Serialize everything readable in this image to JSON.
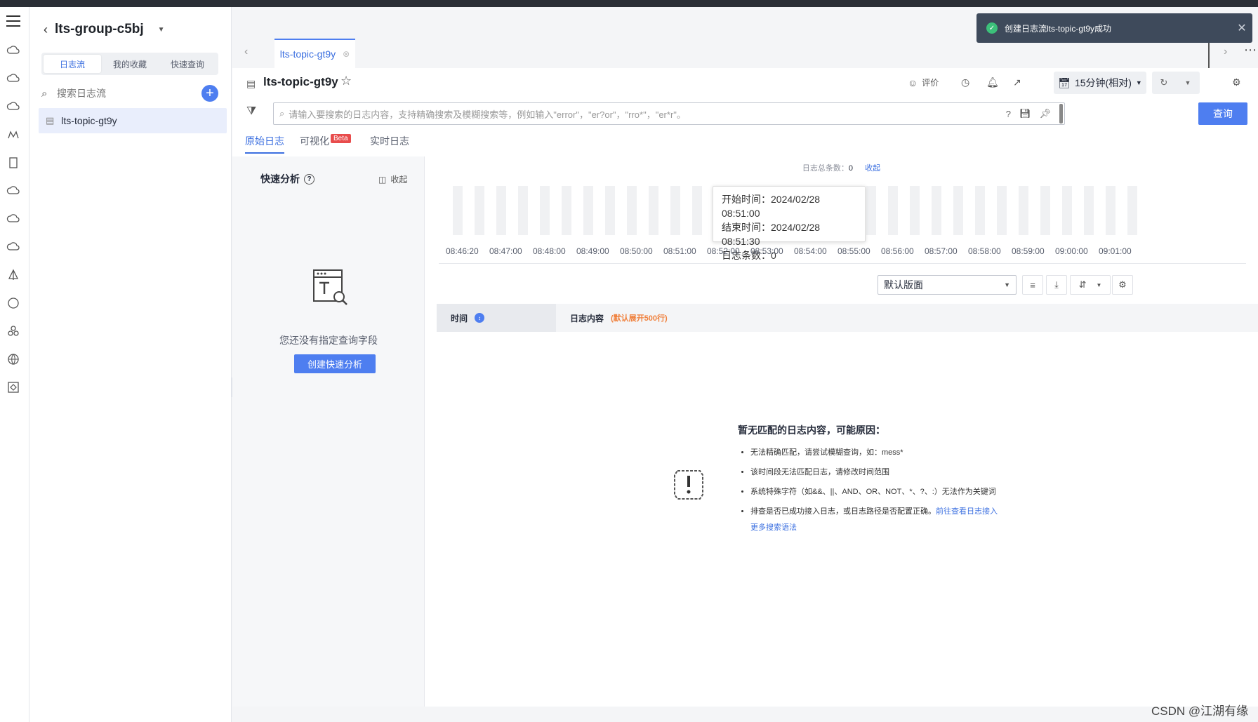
{
  "group": {
    "name": "lts-group-c5bj"
  },
  "left_panel": {
    "segments": [
      "日志流",
      "我的收藏",
      "快速查询"
    ],
    "search_placeholder": "搜索日志流",
    "stream_item": "lts-topic-gt9y"
  },
  "tabs": [
    {
      "label": "lts-topic-gt9y"
    }
  ],
  "header": {
    "title": "lts-topic-gt9y",
    "rate_label": "评价",
    "time_range": "15分钟(相对)"
  },
  "search": {
    "placeholder": "请输入要搜索的日志内容，支持精确搜索及模糊搜索等，例如输入\"error\"，\"er?or\"，\"rro*\"，\"er*r\"。",
    "button": "查询"
  },
  "subtabs": {
    "raw": "原始日志",
    "visual": "可视化",
    "beta": "Beta",
    "realtime": "实时日志"
  },
  "quick_analysis": {
    "title": "快速分析",
    "collapse": "收起",
    "empty_text": "您还没有指定查询字段",
    "create_button": "创建快速分析"
  },
  "histogram": {
    "total_label": "日志总条数：",
    "total_count": "0",
    "fold": "收起",
    "tooltip": {
      "start": "开始时间：2024/02/28 08:51:00",
      "end": "结束时间：2024/02/28 08:51:30",
      "count": "日志条数：0"
    },
    "x_ticks": [
      "08:46:20",
      "08:47:00",
      "08:48:00",
      "08:49:00",
      "08:50:00",
      "08:51:00",
      "08:52:00",
      "08:53:00",
      "08:54:00",
      "08:55:00",
      "08:56:00",
      "08:57:00",
      "08:58:00",
      "08:59:00",
      "09:00:00",
      "09:01:00"
    ]
  },
  "chart_data": {
    "type": "bar",
    "title": "",
    "xlabel": "",
    "ylabel": "",
    "categories": [
      "08:46:20",
      "08:47:00",
      "08:48:00",
      "08:49:00",
      "08:50:00",
      "08:51:00",
      "08:52:00",
      "08:53:00",
      "08:54:00",
      "08:55:00",
      "08:56:00",
      "08:57:00",
      "08:58:00",
      "08:59:00",
      "09:00:00",
      "09:01:00"
    ],
    "values": [
      0,
      0,
      0,
      0,
      0,
      0,
      0,
      0,
      0,
      0,
      0,
      0,
      0,
      0,
      0,
      0
    ]
  },
  "table": {
    "layout": "默认版面",
    "col_time": "时间",
    "col_content": "日志内容",
    "content_hint": "(默认展开500行)"
  },
  "no_match": {
    "title": "暂无匹配的日志内容，可能原因：",
    "reasons": [
      "无法精确匹配，请尝试模糊查询，如：mess*",
      "该时间段无法匹配日志，请修改时间范围",
      "系统特殊字符（如&&、||、AND、OR、NOT、*、?、:）无法作为关键词",
      "排查是否已成功接入日志，或日志路径是否配置正确。"
    ],
    "link": "前往查看日志接入",
    "more": "更多搜索语法"
  },
  "toast": {
    "text": "创建日志流lts-topic-gt9y成功"
  },
  "watermark": "CSDN @江湖有缘"
}
